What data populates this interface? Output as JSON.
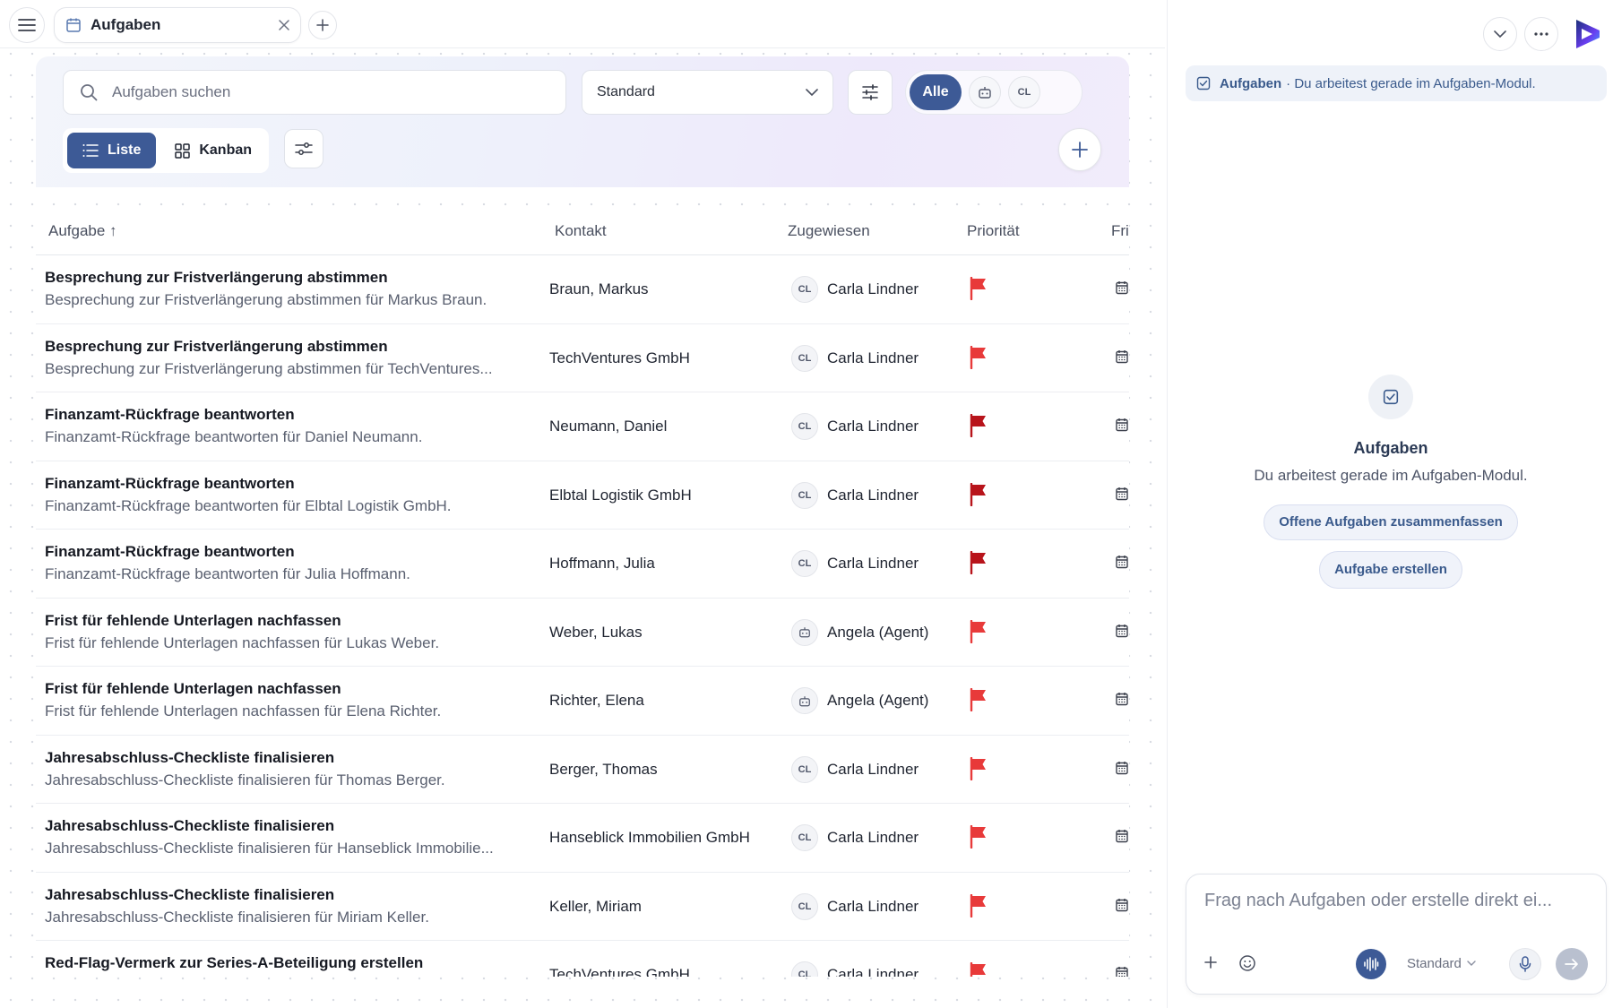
{
  "tabbar": {
    "tab_label": "Aufgaben"
  },
  "toolbar": {
    "search_placeholder": "Aufgaben suchen",
    "view_select": "Standard",
    "segment_all": "Alle",
    "segment_user": "CL",
    "view_list": "Liste",
    "view_kanban": "Kanban"
  },
  "table": {
    "headers": {
      "task": "Aufgabe ↑",
      "contact": "Kontakt",
      "assigned": "Zugewiesen",
      "priority": "Priorität",
      "due": "Fri"
    },
    "rows": [
      {
        "title": "Besprechung zur Fristverlängerung abstimmen",
        "desc": "Besprechung zur Fristverlängerung abstimmen für Markus Braun.",
        "contact": "Braun, Markus",
        "avatar": "CL",
        "assignee": "Carla Lindner",
        "flag": "red"
      },
      {
        "title": "Besprechung zur Fristverlängerung abstimmen",
        "desc": "Besprechung zur Fristverlängerung abstimmen für TechVentures...",
        "contact": "TechVentures GmbH",
        "avatar": "CL",
        "assignee": "Carla Lindner",
        "flag": "red"
      },
      {
        "title": "Finanzamt-Rückfrage beantworten",
        "desc": "Finanzamt-Rückfrage beantworten für Daniel Neumann.",
        "contact": "Neumann, Daniel",
        "avatar": "CL",
        "assignee": "Carla Lindner",
        "flag": "darkred"
      },
      {
        "title": "Finanzamt-Rückfrage beantworten",
        "desc": "Finanzamt-Rückfrage beantworten für Elbtal Logistik GmbH.",
        "contact": "Elbtal Logistik GmbH",
        "avatar": "CL",
        "assignee": "Carla Lindner",
        "flag": "darkred"
      },
      {
        "title": "Finanzamt-Rückfrage beantworten",
        "desc": "Finanzamt-Rückfrage beantworten für Julia Hoffmann.",
        "contact": "Hoffmann, Julia",
        "avatar": "CL",
        "assignee": "Carla Lindner",
        "flag": "darkred"
      },
      {
        "title": "Frist für fehlende Unterlagen nachfassen",
        "desc": "Frist für fehlende Unterlagen nachfassen für Lukas Weber.",
        "contact": "Weber, Lukas",
        "avatar": "agent",
        "assignee": "Angela (Agent)",
        "flag": "red"
      },
      {
        "title": "Frist für fehlende Unterlagen nachfassen",
        "desc": "Frist für fehlende Unterlagen nachfassen für Elena Richter.",
        "contact": "Richter, Elena",
        "avatar": "agent",
        "assignee": "Angela (Agent)",
        "flag": "red"
      },
      {
        "title": "Jahresabschluss-Checkliste finalisieren",
        "desc": "Jahresabschluss-Checkliste finalisieren für Thomas Berger.",
        "contact": "Berger, Thomas",
        "avatar": "CL",
        "assignee": "Carla Lindner",
        "flag": "red"
      },
      {
        "title": "Jahresabschluss-Checkliste finalisieren",
        "desc": "Jahresabschluss-Checkliste finalisieren für Hanseblick Immobilie...",
        "contact": "Hanseblick Immobilien GmbH",
        "avatar": "CL",
        "assignee": "Carla Lindner",
        "flag": "red"
      },
      {
        "title": "Jahresabschluss-Checkliste finalisieren",
        "desc": "Jahresabschluss-Checkliste finalisieren für Miriam Keller.",
        "contact": "Keller, Miriam",
        "avatar": "CL",
        "assignee": "Carla Lindner",
        "flag": "red"
      },
      {
        "title": "Red-Flag-Vermerk zur Series-A-Beteiligung erstellen",
        "desc": "",
        "contact": "TechVentures GmbH",
        "avatar": "CL",
        "assignee": "Carla Lindner",
        "flag": "red"
      }
    ]
  },
  "assistant": {
    "context_module": "Aufgaben",
    "context_text": "· Du arbeitest gerade im Aufgaben-Modul.",
    "title": "Aufgaben",
    "subtitle": "Du arbeitest gerade im Aufgaben-Modul.",
    "suggestion_1": "Offene Aufgaben zusammenfassen",
    "suggestion_2": "Aufgabe erstellen",
    "input_placeholder": "Frag nach Aufgaben oder erstelle direkt ei...",
    "model_label": "Standard"
  },
  "colors": {
    "accent": "#3d5a96",
    "flag_red": "#e83a3a",
    "flag_darkred": "#b8141b"
  }
}
